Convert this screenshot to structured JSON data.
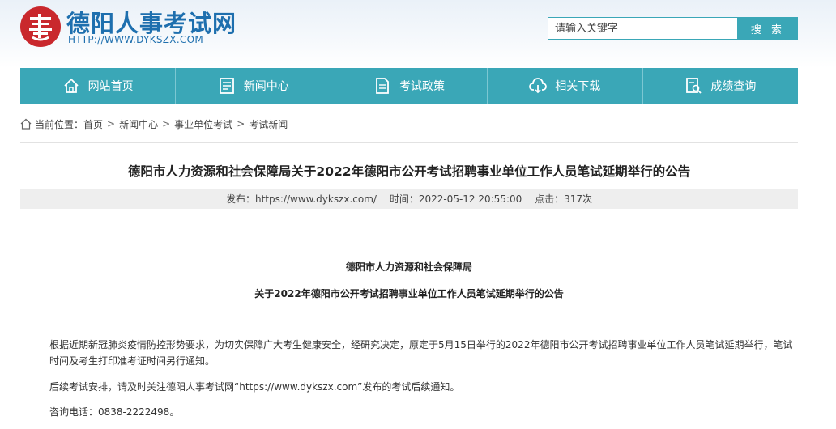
{
  "site": {
    "title": "德阳人事考试网",
    "url": "HTTP://WWW.DYKSZX.COM"
  },
  "search": {
    "placeholder": "请输入关键字",
    "button_label": "搜 索"
  },
  "nav": {
    "items": [
      {
        "label": "网站首页",
        "icon": "home-icon"
      },
      {
        "label": "新闻中心",
        "icon": "news-icon"
      },
      {
        "label": "考试政策",
        "icon": "policy-icon"
      },
      {
        "label": "相关下载",
        "icon": "download-icon"
      },
      {
        "label": "成绩查询",
        "icon": "score-search-icon"
      }
    ]
  },
  "breadcrumb": {
    "prefix": "当前位置：",
    "items": [
      "首页",
      "新闻中心",
      "事业单位考试",
      "考试新闻"
    ],
    "separator": ">"
  },
  "article": {
    "title": "德阳市人力资源和社会保障局关于2022年德阳市公开考试招聘事业单位工作人员笔试延期举行的公告",
    "meta": {
      "source": "发布：https://www.dykszx.com/",
      "time": "时间：2022-05-12 20:55:00",
      "clicks": "点击：317次"
    },
    "org": "德阳市人力资源和社会保障局",
    "notice_title": "关于2022年德阳市公开考试招聘事业单位工作人员笔试延期举行的公告",
    "paragraphs": [
      "根据近期新冠肺炎疫情防控形势要求，为切实保障广大考生健康安全，经研究决定，原定于5月15日举行的2022年德阳市公开考试招聘事业单位工作人员笔试延期举行，笔试时间及考生打印准考证时间另行通知。",
      "后续考试安排，请及时关注德阳人事考试网“https://www.dykszx.com”发布的考试后续通知。",
      "咨询电话：0838-2222498。"
    ]
  },
  "colors": {
    "accent": "#3aa7b7",
    "title_blue": "#1e6fae",
    "logo_red": "#c9282d"
  }
}
